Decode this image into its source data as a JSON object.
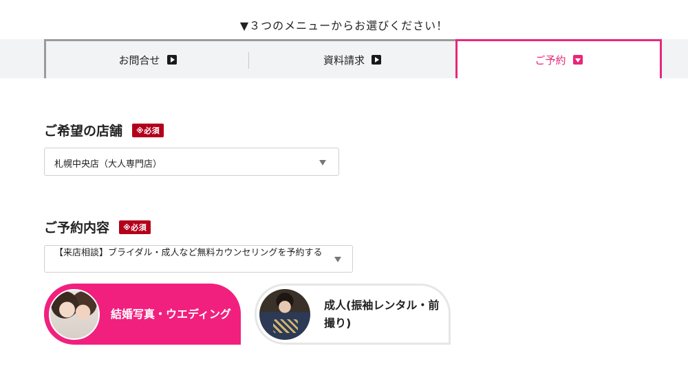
{
  "hint": "▼３つのメニューからお選びください！",
  "tabs": [
    {
      "label": "お問合せ",
      "icon": "play-icon"
    },
    {
      "label": "資料請求",
      "icon": "play-icon"
    },
    {
      "label": "ご予約",
      "icon": "chevron-down-icon",
      "active": true
    }
  ],
  "store": {
    "title": "ご希望の店舗",
    "required": "※必須",
    "selected": "札幌中央店（大人専門店）"
  },
  "reservation": {
    "title": "ご予約内容",
    "required": "※必須",
    "selected": "【来店相談】ブライダル・成人など無料カウンセリングを予約する"
  },
  "choices": [
    {
      "label": "結婚写真・ウエディング",
      "selected": true
    },
    {
      "label": "成人(振袖レンタル・前撮り)",
      "selected": false
    }
  ],
  "colors": {
    "accent": "#e8267a",
    "required_badge": "#b3001b",
    "tab_border": "#9a9a9a",
    "tab_background": "#f2f3f4"
  }
}
